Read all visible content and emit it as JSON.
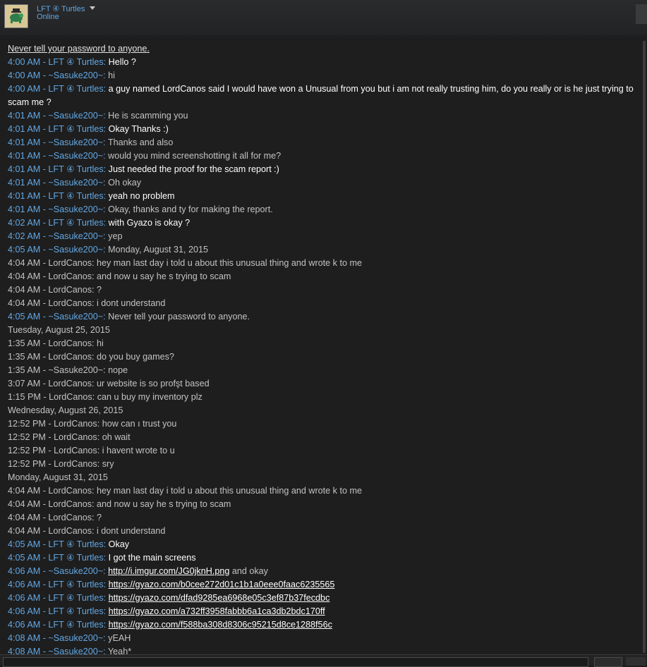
{
  "header": {
    "friend_name": "LFT ④ Turtles",
    "status": "Online",
    "avatar_icon": "turtle-avatar-icon"
  },
  "chat": {
    "warning": "Never tell your password to anyone.",
    "lines": [
      {
        "kind": "self",
        "time": "4:00 AM",
        "sender": "LFT ④ Turtles",
        "text": "Hello ?"
      },
      {
        "kind": "other",
        "time": "4:00 AM",
        "sender": "~Sasuke200~",
        "text": "hi"
      },
      {
        "kind": "self",
        "time": "4:00 AM",
        "sender": "LFT ④ Turtles",
        "text": "a guy named LordCanos said I would have won a Unusual from you but i am not really trusting him, do you really or is he just trying to scam me ?"
      },
      {
        "kind": "other",
        "time": "4:01 AM",
        "sender": "~Sasuke200~",
        "text": "He is scamming you"
      },
      {
        "kind": "self",
        "time": "4:01 AM",
        "sender": "LFT ④ Turtles",
        "text": "Okay Thanks :)"
      },
      {
        "kind": "other",
        "time": "4:01 AM",
        "sender": "~Sasuke200~",
        "text": "Thanks and also"
      },
      {
        "kind": "other",
        "time": "4:01 AM",
        "sender": "~Sasuke200~",
        "text": "would you mind screenshotting it all for me?"
      },
      {
        "kind": "self",
        "time": "4:01 AM",
        "sender": "LFT ④ Turtles",
        "text": "Just needed the proof for the scam report :)"
      },
      {
        "kind": "other",
        "time": "4:01 AM",
        "sender": "~Sasuke200~",
        "text": "Oh okay"
      },
      {
        "kind": "self",
        "time": "4:01 AM",
        "sender": "LFT ④ Turtles",
        "text": "yeah no problem"
      },
      {
        "kind": "other",
        "time": "4:01 AM",
        "sender": "~Sasuke200~",
        "text": "Okay, thanks and ty for making the report."
      },
      {
        "kind": "self",
        "time": "4:02 AM",
        "sender": "LFT ④ Turtles",
        "text": "with Gyazo is okay ?"
      },
      {
        "kind": "other",
        "time": "4:02 AM",
        "sender": "~Sasuke200~",
        "text": "yep"
      },
      {
        "kind": "other",
        "time": "4:05 AM",
        "sender": "~Sasuke200~",
        "text": "Monday, August 31, 2015"
      },
      {
        "kind": "plain",
        "text": "4:04 AM - LordCanos: hey man last day i  told u about this unusual thing and  wrote k to me"
      },
      {
        "kind": "plain",
        "text": "4:04 AM - LordCanos: and now u say he s trying to scam"
      },
      {
        "kind": "plain",
        "text": "4:04 AM - LordCanos: ?"
      },
      {
        "kind": "plain",
        "text": "4:04 AM - LordCanos: i dont understand"
      },
      {
        "kind": "other",
        "time": "4:05 AM",
        "sender": "~Sasuke200~",
        "text": "Never tell your password to anyone."
      },
      {
        "kind": "plain",
        "text": "Tuesday, August 25, 2015"
      },
      {
        "kind": "plain",
        "text": "1:35 AM - LordCanos: hi"
      },
      {
        "kind": "plain",
        "text": "1:35 AM - LordCanos: do you buy games?"
      },
      {
        "kind": "plain",
        "text": "1:35 AM - ~Sasuke200~: nope"
      },
      {
        "kind": "plain",
        "text": "3:07 AM - LordCanos: ur website is so profşt based"
      },
      {
        "kind": "plain",
        "text": "1:15 PM - LordCanos: can u buy my inventory plz"
      },
      {
        "kind": "plain",
        "text": "Wednesday, August 26, 2015"
      },
      {
        "kind": "plain",
        "text": "12:52 PM - LordCanos: how can ı trust you"
      },
      {
        "kind": "plain",
        "text": "12:52 PM - LordCanos: oh wait"
      },
      {
        "kind": "plain",
        "text": "12:52 PM - LordCanos: i havent wrote to u"
      },
      {
        "kind": "plain",
        "text": "12:52 PM - LordCanos: sry"
      },
      {
        "kind": "plain",
        "text": "Monday, August 31, 2015"
      },
      {
        "kind": "plain",
        "text": "4:04 AM - LordCanos: hey man last day i  told u about this unusual thing and  wrote k to me"
      },
      {
        "kind": "plain",
        "text": "4:04 AM - LordCanos: and now u say he s trying to scam"
      },
      {
        "kind": "plain",
        "text": "4:04 AM - LordCanos: ?"
      },
      {
        "kind": "plain",
        "text": "4:04 AM - LordCanos: i dont understand"
      },
      {
        "kind": "self",
        "time": "4:05 AM",
        "sender": "LFT ④ Turtles",
        "text": "Okay"
      },
      {
        "kind": "self",
        "time": "4:05 AM",
        "sender": "LFT ④ Turtles",
        "text": "I got the main screens"
      },
      {
        "kind": "other",
        "time": "4:06 AM",
        "sender": "~Sasuke200~",
        "link": "http://i.imgur.com/JG0jknH.png",
        "text": " and okay"
      },
      {
        "kind": "self",
        "time": "4:06 AM",
        "sender": "LFT ④ Turtles",
        "link": "https://gyazo.com/b0cee272d01c1b1a0eee0faac6235565",
        "text": ""
      },
      {
        "kind": "self",
        "time": "4:06 AM",
        "sender": "LFT ④ Turtles",
        "link": "https://gyazo.com/dfad9285ea6968e05c3ef87b37fecdbc",
        "text": ""
      },
      {
        "kind": "self",
        "time": "4:06 AM",
        "sender": "LFT ④ Turtles",
        "link": "https://gyazo.com/a732ff3958fabbb6a1ca3db2bdc170ff",
        "text": ""
      },
      {
        "kind": "self",
        "time": "4:06 AM",
        "sender": "LFT ④ Turtles",
        "link": "https://gyazo.com/f588ba308d8306c95215d8ce1288f56c",
        "text": ""
      },
      {
        "kind": "other",
        "time": "4:08 AM",
        "sender": "~Sasuke200~",
        "text": "yEAH"
      },
      {
        "kind": "other",
        "time": "4:08 AM",
        "sender": "~Sasuke200~",
        "text": "Yeah*"
      }
    ]
  },
  "footer": {
    "input_value": ""
  }
}
